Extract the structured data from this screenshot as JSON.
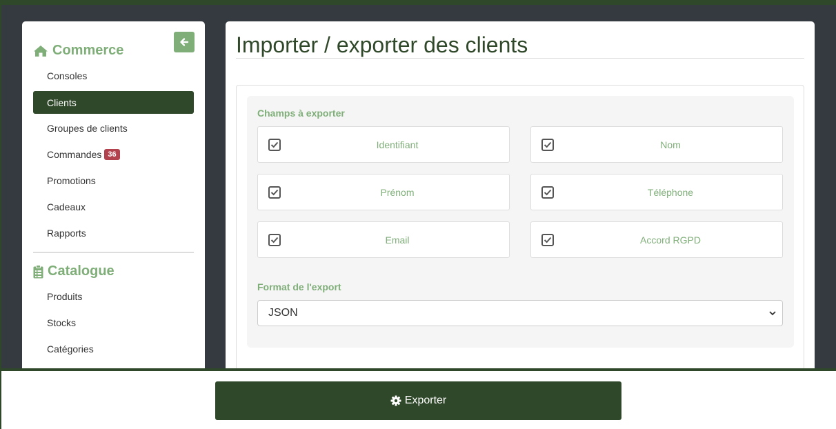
{
  "sidebar": {
    "commerce_title": "Commerce",
    "commerce_items": [
      {
        "label": "Consoles"
      },
      {
        "label": "Clients"
      },
      {
        "label": "Groupes de clients"
      },
      {
        "label": "Commandes",
        "badge": "36"
      },
      {
        "label": "Promotions"
      },
      {
        "label": "Cadeaux"
      },
      {
        "label": "Rapports"
      }
    ],
    "catalogue_title": "Catalogue",
    "catalogue_items": [
      {
        "label": "Produits"
      },
      {
        "label": "Stocks"
      },
      {
        "label": "Catégories"
      }
    ],
    "active_item": "Clients"
  },
  "main": {
    "title": "Importer / exporter des clients",
    "fields_label": "Champs à exporter",
    "fields": [
      {
        "label": "Identifiant",
        "checked": true
      },
      {
        "label": "Nom",
        "checked": true
      },
      {
        "label": "Prénom",
        "checked": true
      },
      {
        "label": "Téléphone",
        "checked": true
      },
      {
        "label": "Email",
        "checked": true
      },
      {
        "label": "Accord RGPD",
        "checked": true
      }
    ],
    "format_label": "Format de l'export",
    "format_value": "JSON"
  },
  "footer": {
    "export_label": "Exporter"
  },
  "colors": {
    "accent": "#7fae79",
    "dark_green": "#30482a",
    "badge": "#b2434e",
    "background": "#343a40"
  }
}
